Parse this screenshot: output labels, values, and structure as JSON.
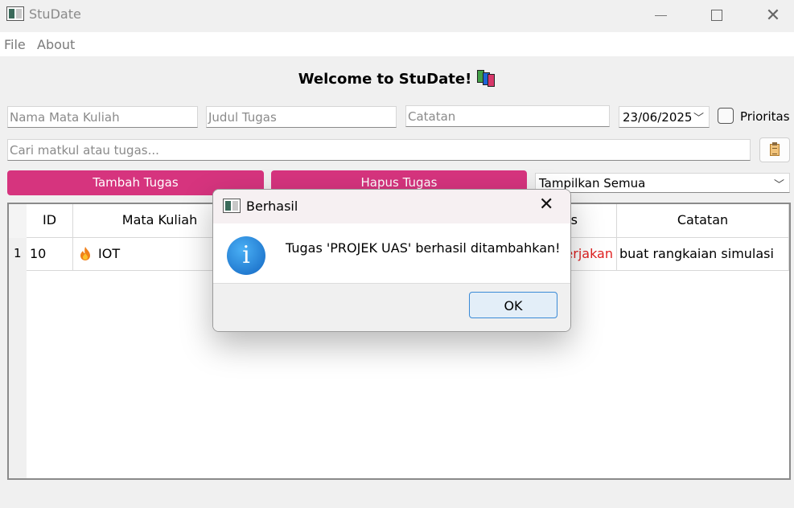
{
  "window": {
    "title": "StuDate"
  },
  "menu": {
    "file": "File",
    "about": "About"
  },
  "heading": {
    "text": "Welcome to StuDate!"
  },
  "form": {
    "matkul_placeholder": "Nama Mata Kuliah",
    "judul_placeholder": "Judul Tugas",
    "catatan_placeholder": "Catatan",
    "date_value": "23/06/2025",
    "priority_label": "Prioritas",
    "search_placeholder": "Cari matkul atau tugas..."
  },
  "buttons": {
    "add": "Tambah Tugas",
    "delete": "Hapus Tugas"
  },
  "filter": {
    "selected": "Tampilkan Semua"
  },
  "table": {
    "headers": {
      "id": "ID",
      "matkul": "Mata Kuliah",
      "status_partial": "s",
      "catatan": "Catatan"
    },
    "rows": [
      {
        "num": "1",
        "id": "10",
        "matkul": "IOT",
        "status_partial": "erjakan",
        "catatan": "buat rangkaian simulasi"
      }
    ]
  },
  "dialog": {
    "title": "Berhasil",
    "message": "Tugas 'PROJEK UAS' berhasil ditambahkan!",
    "ok": "OK"
  },
  "colors": {
    "accent": "#d6347e",
    "status_red": "#e02020",
    "ok_border": "#3a8ad6"
  }
}
